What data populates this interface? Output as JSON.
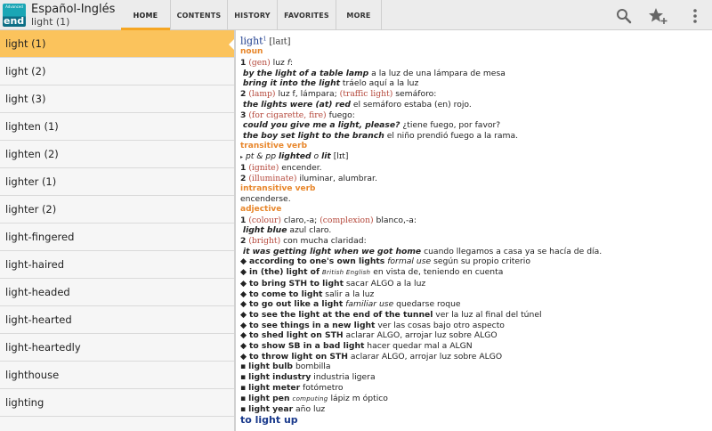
{
  "header": {
    "app_title": "Español-Inglés",
    "current_word": "light (1)",
    "icon_top_text": "Advanced",
    "icon_bottom_text": "end"
  },
  "tabs": [
    {
      "label": "HOME",
      "active": true
    },
    {
      "label": "CONTENTS",
      "active": false
    },
    {
      "label": "HISTORY",
      "active": false
    },
    {
      "label": "FAVORITES",
      "active": false
    },
    {
      "label": "MORE",
      "active": false
    }
  ],
  "actions": {
    "search": "search-icon",
    "favorite": "star-plus-icon",
    "overflow": "overflow-menu-icon"
  },
  "colors": {
    "accent": "#f5a623",
    "selected_row": "#fbc35c",
    "headword": "#1a3a8c",
    "pos": "#e8862a",
    "context": "#b4473a"
  },
  "word_list": [
    "light (1)",
    "light (2)",
    "light (3)",
    "lighten (1)",
    "lighten (2)",
    "lighter (1)",
    "lighter (2)",
    "light-fingered",
    "light-haired",
    "light-headed",
    "light-hearted",
    "light-heartedly",
    "lighthouse",
    "lighting"
  ],
  "entry": {
    "headword": "light",
    "homograph": "1",
    "pronunciation": "[laɪt]",
    "pos_noun": "noun",
    "s1_num": "1",
    "s1_ctx": "(gen)",
    "s1_tr": "luz",
    "s1_gender": "f",
    "ex1_en": "by the light of a table lamp",
    "ex1_es": "a la luz de una lámpara de mesa",
    "ex2_en": "bring it into the light",
    "ex2_es": "tráelo aquí a la luz",
    "s2_num": "2",
    "s2_ctx": "(lamp)",
    "s2_tr": "luz f, lámpara;",
    "s2_ctx2": "(traffic light)",
    "s2_tr2": "semáforo:",
    "ex3_en": "the lights were (at) red",
    "ex3_es": "el semáforo estaba (en) rojo.",
    "s3_num": "3",
    "s3_ctx": "(for cigarette, fire)",
    "s3_tr": "fuego:",
    "ex4_en": "could you give me a light, please?",
    "ex4_es": "¿tiene fuego, por favor?",
    "ex5_en": "the boy set light to the branch",
    "ex5_es": "el niño prendió fuego a la rama.",
    "pos_tv": "transitive verb",
    "tv_forms_pre": "pt & pp",
    "tv_forms": "lighted",
    "tv_forms_o": "o",
    "tv_forms2": "lit",
    "tv_pron2": "[lɪt]",
    "tv1_num": "1",
    "tv1_ctx": "(ignite)",
    "tv1_tr": "encender.",
    "tv2_num": "2",
    "tv2_ctx": "(illuminate)",
    "tv2_tr": "iluminar, alumbrar.",
    "pos_iv": "intransitive verb",
    "iv_tr": "encenderse.",
    "pos_adj": "adjective",
    "adj1_num": "1",
    "adj1_ctx": "(colour)",
    "adj1_tr": "claro,-a;",
    "adj1_ctx2": "(complexion)",
    "adj1_tr2": "blanco,-a:",
    "ex6_en": "light blue",
    "ex6_es": "azul claro.",
    "adj2_num": "2",
    "adj2_ctx": "(bright)",
    "adj2_tr": "con mucha claridad:",
    "ex7_en": "it was getting light when we got home",
    "ex7_es": "cuando llegamos a casa ya se hacía de día.",
    "idioms": [
      {
        "en": "according to one's own lights",
        "label": "formal use",
        "es": "según su propio criterio"
      },
      {
        "en": "in (the) light of",
        "label": "British English",
        "es": "en vista de, teniendo en cuenta"
      },
      {
        "en": "to bring STH to light",
        "label": "",
        "es": "sacar ALGO a la luz"
      },
      {
        "en": "to come to light",
        "label": "",
        "es": "salir a la luz"
      },
      {
        "en": "to go out like a light",
        "label": "familiar use",
        "es": "quedarse roque"
      },
      {
        "en": "to see the light at the end of the tunnel",
        "label": "",
        "es": "ver la luz al final del túnel"
      },
      {
        "en": "to see things in a new light",
        "label": "",
        "es": "ver las cosas bajo otro aspecto"
      },
      {
        "en": "to shed light on STH",
        "label": "",
        "es": "aclarar ALGO, arrojar luz sobre ALGO"
      },
      {
        "en": "to show SB in a bad light",
        "label": "",
        "es": "hacer quedar mal a ALGN"
      },
      {
        "en": "to throw light on STH",
        "label": "",
        "es": "aclarar ALGO, arrojar luz sobre ALGO"
      }
    ],
    "compounds": [
      {
        "en": "light bulb",
        "label": "",
        "es": "bombilla"
      },
      {
        "en": "light industry",
        "label": "",
        "es": "industria ligera"
      },
      {
        "en": "light meter",
        "label": "",
        "es": "fotómetro"
      },
      {
        "en": "light pen",
        "label": "computing",
        "es": "lápiz m óptico"
      },
      {
        "en": "light year",
        "label": "",
        "es": "año luz"
      }
    ],
    "xref": "to light up"
  }
}
